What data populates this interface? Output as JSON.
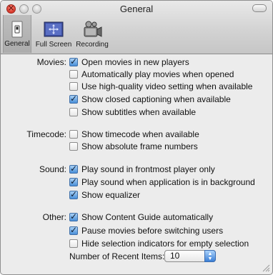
{
  "window": {
    "title": "General"
  },
  "toolbar": {
    "items": [
      {
        "label": "General",
        "icon": "light-switch-icon",
        "selected": true
      },
      {
        "label": "Full Screen",
        "icon": "full-screen-icon",
        "selected": false
      },
      {
        "label": "Recording",
        "icon": "video-camera-icon",
        "selected": false
      }
    ]
  },
  "movies": {
    "label": "Movies:",
    "options": [
      {
        "label": "Open movies in new players",
        "checked": true
      },
      {
        "label": "Automatically play movies when opened",
        "checked": false
      },
      {
        "label": "Use high-quality video setting when available",
        "checked": false
      },
      {
        "label": "Show closed captioning when available",
        "checked": true
      },
      {
        "label": "Show subtitles when available",
        "checked": false
      }
    ]
  },
  "timecode": {
    "label": "Timecode:",
    "options": [
      {
        "label": "Show timecode when available",
        "checked": false
      },
      {
        "label": "Show absolute frame numbers",
        "checked": false
      }
    ]
  },
  "sound": {
    "label": "Sound:",
    "options": [
      {
        "label": "Play sound in frontmost player only",
        "checked": true
      },
      {
        "label": "Play sound when application is in background",
        "checked": true
      },
      {
        "label": "Show equalizer",
        "checked": true
      }
    ]
  },
  "other": {
    "label": "Other:",
    "options": [
      {
        "label": "Show Content Guide automatically",
        "checked": true
      },
      {
        "label": "Pause movies before switching users",
        "checked": true
      },
      {
        "label": "Hide selection indicators for empty selection",
        "checked": false
      }
    ],
    "recent_items_label": "Number of Recent Items:",
    "recent_items_value": "10"
  },
  "colors": {
    "checkbox_checked": "#4a8fd8",
    "toolbar_selected": "#b4b4b4",
    "close_button": "#d9372a"
  }
}
